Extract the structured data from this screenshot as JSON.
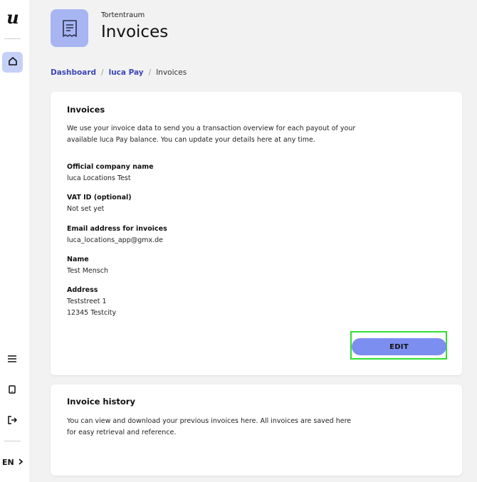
{
  "sidebar": {
    "logo": "u",
    "language": "EN"
  },
  "header": {
    "venue_name": "Tortentraum",
    "title": "Invoices"
  },
  "breadcrumb": {
    "items": [
      {
        "label": "Dashboard"
      },
      {
        "label": "luca Pay"
      },
      {
        "label": "Invoices"
      }
    ],
    "separator": "/"
  },
  "invoices_card": {
    "title": "Invoices",
    "description": "We use your invoice data to send you a transaction overview for each payout of your available luca Pay balance. You can update your details here at any time.",
    "fields": [
      {
        "label": "Official company name",
        "value": "luca Locations Test"
      },
      {
        "label": "VAT ID (optional)",
        "value": "Not set yet"
      },
      {
        "label": "Email address for invoices",
        "value": "luca_locations_app@gmx.de"
      },
      {
        "label": "Name",
        "value": "Test Mensch"
      },
      {
        "label": "Address",
        "value": "Teststreet 1",
        "value2": "12345 Testcity"
      }
    ],
    "edit_label": "EDIT"
  },
  "history_card": {
    "title": "Invoice history",
    "description": "You can view and download your previous invoices here. All invoices are saved here for easy retrieval and reference."
  },
  "colors": {
    "accent": "#7c8ef0",
    "link": "#3b48b6",
    "icon_bg": "#a7b5f2",
    "highlight": "#2ee02e"
  }
}
